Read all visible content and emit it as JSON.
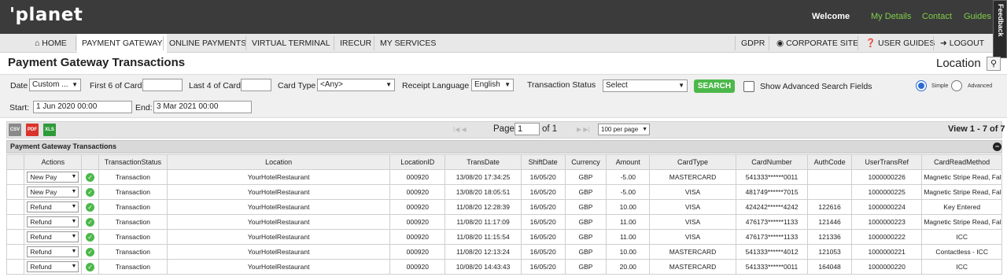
{
  "header": {
    "logo": "'planet",
    "welcome": "Welcome",
    "links": [
      "My Details",
      "Contact",
      "Guides"
    ],
    "feedback": "Feedback"
  },
  "nav": {
    "left": [
      {
        "label": "HOME",
        "icon": "home-icon"
      },
      {
        "label": "PAYMENT GATEWAY",
        "active": true
      },
      {
        "label": "ONLINE PAYMENTS"
      },
      {
        "label": "VIRTUAL TERMINAL"
      },
      {
        "label": "IRECUR"
      },
      {
        "label": "MY SERVICES"
      }
    ],
    "right": [
      {
        "label": "GDPR"
      },
      {
        "label": "CORPORATE SITE",
        "icon": "globe-icon"
      },
      {
        "label": "USER GUIDES",
        "icon": "question-icon"
      },
      {
        "label": "LOGOUT",
        "icon": "logout-icon"
      }
    ]
  },
  "page": {
    "title": "Payment Gateway Transactions",
    "location_label": "Location"
  },
  "filters": {
    "date_label": "Date",
    "date_value": "Custom ...",
    "first6_label": "First 6 of Card",
    "first6_value": "",
    "last4_label": "Last 4 of Card",
    "last4_value": "",
    "card_type_label": "Card Type",
    "card_type_value": "<Any>",
    "receipt_language_label": "Receipt Language",
    "receipt_language_value": "English",
    "transaction_status_label": "Transaction Status",
    "transaction_status_value": "Select",
    "search_button": "SEARCH",
    "advanced_fields_label": "Show Advanced Search Fields",
    "simple_label": "Simple",
    "advanced_label": "Advanced",
    "start_label": "Start:",
    "start_value": "1 Jun 2020 00:00",
    "end_label": "End:",
    "end_value": "3 Mar 2021 00:00"
  },
  "toolbar": {
    "exports": [
      {
        "label": "CSV",
        "color": "#8a8a8a"
      },
      {
        "label": "PDF",
        "color": "#d9342b"
      },
      {
        "label": "XLS",
        "color": "#2f9a3a"
      }
    ],
    "page_label": "Page",
    "page_value": "1",
    "of_label": "of 1",
    "per_page": "100 per page",
    "view_count": "View 1 - 7 of 7"
  },
  "grid": {
    "caption": "Payment Gateway Transactions",
    "columns": [
      "",
      "Actions",
      "",
      "TransactionStatus",
      "Location",
      "LocationID",
      "TransDate",
      "ShiftDate",
      "Currency",
      "Amount",
      "CardType",
      "CardNumber",
      "AuthCode",
      "UserTransRef",
      "CardReadMethod"
    ],
    "rows": [
      {
        "action": "New Pay",
        "status": "Transaction",
        "location": "YourHotelRestaurant",
        "location_id": "000920",
        "trans_date": "13/08/20 17:34:25",
        "shift_date": "16/05/20",
        "currency": "GBP",
        "amount": "-5.00",
        "card_type": "MASTERCARD",
        "card_number": "541333******0011",
        "auth_code": "",
        "user_trans_ref": "1000000226",
        "card_read_method": "Magnetic Stripe Read, Fallb"
      },
      {
        "action": "New Pay",
        "status": "Transaction",
        "location": "YourHotelRestaurant",
        "location_id": "000920",
        "trans_date": "13/08/20 18:05:51",
        "shift_date": "16/05/20",
        "currency": "GBP",
        "amount": "-5.00",
        "card_type": "VISA",
        "card_number": "481749******7015",
        "auth_code": "",
        "user_trans_ref": "1000000225",
        "card_read_method": "Magnetic Stripe Read, Fallb"
      },
      {
        "action": "Refund",
        "status": "Transaction",
        "location": "YourHotelRestaurant",
        "location_id": "000920",
        "trans_date": "11/08/20 12:28:39",
        "shift_date": "16/05/20",
        "currency": "GBP",
        "amount": "10.00",
        "card_type": "VISA",
        "card_number": "424242******4242",
        "auth_code": "122616",
        "user_trans_ref": "1000000224",
        "card_read_method": "Key Entered"
      },
      {
        "action": "Refund",
        "status": "Transaction",
        "location": "YourHotelRestaurant",
        "location_id": "000920",
        "trans_date": "11/08/20 11:17:09",
        "shift_date": "16/05/20",
        "currency": "GBP",
        "amount": "11.00",
        "card_type": "VISA",
        "card_number": "476173******1133",
        "auth_code": "121446",
        "user_trans_ref": "1000000223",
        "card_read_method": "Magnetic Stripe Read, Fallb"
      },
      {
        "action": "Refund",
        "status": "Transaction",
        "location": "YourHotelRestaurant",
        "location_id": "000920",
        "trans_date": "11/08/20 11:15:54",
        "shift_date": "16/05/20",
        "currency": "GBP",
        "amount": "11.00",
        "card_type": "VISA",
        "card_number": "476173******1133",
        "auth_code": "121336",
        "user_trans_ref": "1000000222",
        "card_read_method": "ICC"
      },
      {
        "action": "Refund",
        "status": "Transaction",
        "location": "YourHotelRestaurant",
        "location_id": "000920",
        "trans_date": "11/08/20 12:13:24",
        "shift_date": "16/05/20",
        "currency": "GBP",
        "amount": "10.00",
        "card_type": "MASTERCARD",
        "card_number": "541333******4012",
        "auth_code": "121053",
        "user_trans_ref": "1000000221",
        "card_read_method": "Contactless - ICC"
      },
      {
        "action": "Refund",
        "status": "Transaction",
        "location": "YourHotelRestaurant",
        "location_id": "000920",
        "trans_date": "10/08/20 14:43:43",
        "shift_date": "16/05/20",
        "currency": "GBP",
        "amount": "20.00",
        "card_type": "MASTERCARD",
        "card_number": "541333******0011",
        "auth_code": "164048",
        "user_trans_ref": "1000000220",
        "card_read_method": "ICC"
      }
    ]
  },
  "colors": {
    "topbar": "#3b3b3b",
    "link_green": "#7fcf4a",
    "accent_green": "#4cb84a",
    "radio_blue": "#2a6bd3"
  }
}
